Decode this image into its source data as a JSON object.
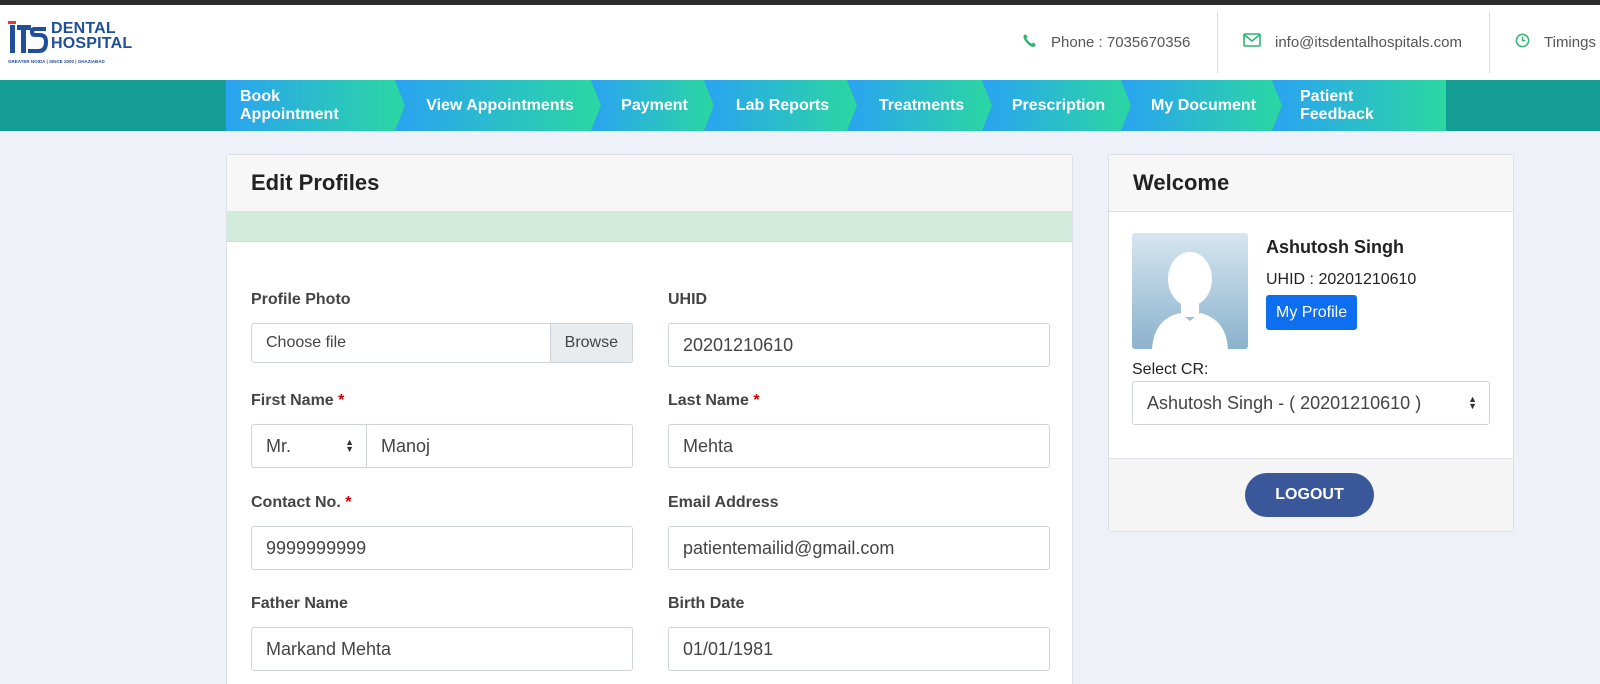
{
  "header": {
    "logo_title_line1": "DENTAL",
    "logo_title_line2": "HOSPITAL",
    "logo_subtitle": "GREATER NOIDA | SINCE 2000 | GHAZIABAD",
    "phone": "Phone : 7035670356",
    "email": "info@itsdentalhospitals.com",
    "timings": "Timings"
  },
  "nav": {
    "tabs": [
      "Book Appointment",
      "View Appointments",
      "Payment",
      "Lab Reports",
      "Treatments",
      "Prescription",
      "My Document",
      "Patient Feedback"
    ]
  },
  "edit_profile": {
    "title": "Edit Profiles",
    "profile_photo_label": "Profile Photo",
    "file_placeholder": "Choose file",
    "browse_label": "Browse",
    "uhid_label": "UHID",
    "uhid_value": "20201210610",
    "first_name_label": "First Name",
    "salutation_value": "Mr.",
    "first_name_value": "Manoj",
    "last_name_label": "Last Name",
    "last_name_value": "Mehta",
    "contact_label": "Contact No.",
    "contact_value": "9999999999",
    "email_label": "Email Address",
    "email_value": "patientemailid@gmail.com",
    "father_label": "Father Name",
    "father_value": "Markand Mehta",
    "birth_label": "Birth Date",
    "birth_value": "01/01/1981",
    "required_marker": "*"
  },
  "welcome": {
    "title": "Welcome",
    "name": "Ashutosh Singh",
    "uhid": "UHID : 20201210610",
    "my_profile_label": "My Profile",
    "select_cr_label": "Select CR:",
    "select_cr_value": "Ashutosh Singh - ( 20201210610 )",
    "logout_label": "LOGOUT"
  },
  "colors": {
    "nav_bg": "#159e94",
    "tab_gradient_start": "#2aa3f2",
    "tab_gradient_end": "#2bd7a1",
    "logout_button": "#3a5799",
    "profile_button": "#0d6ef0",
    "alert_bg": "#d3ebdc",
    "icon_green": "#2bb673"
  },
  "icons": {
    "phone": "phone-icon",
    "email": "envelope-icon",
    "timings": "clock-icon"
  }
}
